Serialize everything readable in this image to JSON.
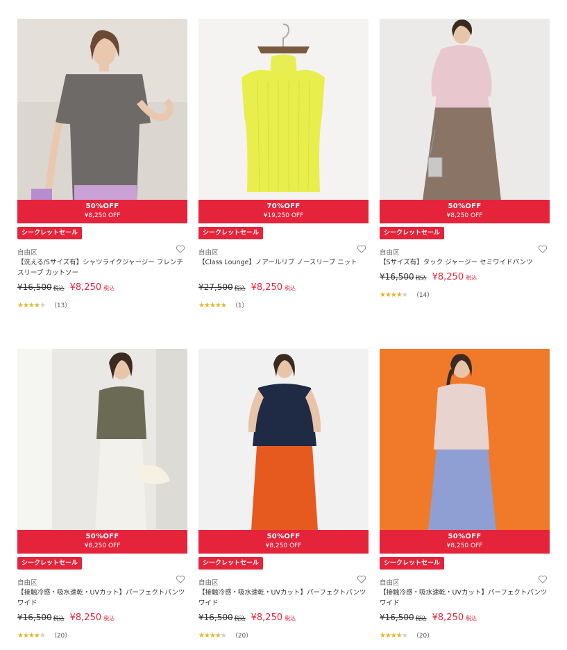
{
  "colors": {
    "sale_red": "#e5233a",
    "star_gold": "#e6b422"
  },
  "products": [
    {
      "discount": "50%OFF",
      "banner_price": "¥8,250 OFF",
      "tag": "シークレットセール",
      "brand": "自由区",
      "title": "【洗える/Sサイズ有】シャツライクジャージー フレンチスリーブ カットソー",
      "old_price": "¥16,500",
      "old_tax": "税込",
      "new_price": "¥8,250",
      "new_tax": "税込",
      "rating": 4,
      "review_count": "（13）",
      "heart_icon": "heart-outline-icon"
    },
    {
      "discount": "70%OFF",
      "banner_price": "¥19,250 OFF",
      "tag": "シークレットセール",
      "brand": "自由区",
      "title": "【Class Lounge】ノアールリブ ノースリーブ ニット",
      "old_price": "¥27,500",
      "old_tax": "税込",
      "new_price": "¥8,250",
      "new_tax": "税込",
      "rating": 5,
      "review_count": "（1）",
      "heart_icon": "heart-outline-icon"
    },
    {
      "discount": "50%OFF",
      "banner_price": "¥8,250 OFF",
      "tag": "シークレットセール",
      "brand": "自由区",
      "title": "【Sサイズ有】タック ジャージー セミワイドパンツ",
      "old_price": "¥16,500",
      "old_tax": "税込",
      "new_price": "¥8,250",
      "new_tax": "税込",
      "rating": 4.5,
      "review_count": "（14）",
      "heart_icon": "heart-outline-icon"
    },
    {
      "discount": "50%OFF",
      "banner_price": "¥8,250 OFF",
      "tag": "シークレットセール",
      "brand": "自由区",
      "title": "【接触冷感・吸水速乾・UVカット】パーフェクトパンツ ワイド",
      "old_price": "¥16,500",
      "old_tax": "税込",
      "new_price": "¥8,250",
      "new_tax": "税込",
      "rating": 4.5,
      "review_count": "（20）",
      "heart_icon": "heart-outline-icon"
    },
    {
      "discount": "50%OFF",
      "banner_price": "¥8,250 OFF",
      "tag": "シークレットセール",
      "brand": "自由区",
      "title": "【接触冷感・吸水速乾・UVカット】パーフェクトパンツ ワイド",
      "old_price": "¥16,500",
      "old_tax": "税込",
      "new_price": "¥8,250",
      "new_tax": "税込",
      "rating": 4.5,
      "review_count": "（20）",
      "heart_icon": "heart-outline-icon"
    },
    {
      "discount": "50%OFF",
      "banner_price": "¥8,250 OFF",
      "tag": "シークレットセール",
      "brand": "自由区",
      "title": "【接触冷感・吸水速乾・UVカット】パーフェクトパンツ ワイド",
      "old_price": "¥16,500",
      "old_tax": "税込",
      "new_price": "¥8,250",
      "new_tax": "税込",
      "rating": 4.5,
      "review_count": "（20）",
      "heart_icon": "heart-outline-icon"
    }
  ]
}
